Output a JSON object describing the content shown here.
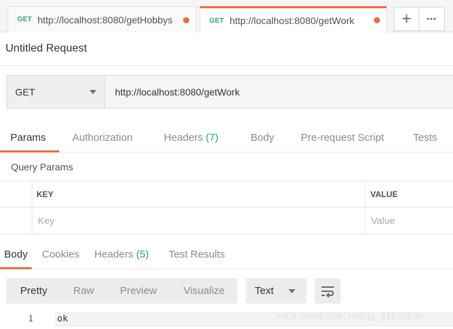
{
  "tabs": [
    {
      "method": "GET",
      "url": "http://localhost:8080/getHobbys",
      "unsaved": true,
      "active": false
    },
    {
      "method": "GET",
      "url": "http://localhost:8080/getWork",
      "unsaved": true,
      "active": true
    }
  ],
  "tab_actions": {
    "add_icon": "plus-icon",
    "more_icon": "more-icon",
    "add_glyph": "+",
    "more_glyph": "•••"
  },
  "request": {
    "title": "Untitled Request",
    "method": "GET",
    "url": "http://localhost:8080/getWork"
  },
  "request_tabs": {
    "params": "Params",
    "authorization": "Authorization",
    "headers": "Headers",
    "headers_count": "(7)",
    "body": "Body",
    "pre_request_script": "Pre-request Script",
    "tests": "Tests"
  },
  "query_params": {
    "label": "Query Params",
    "columns": {
      "key": "KEY",
      "value": "VALUE"
    },
    "placeholders": {
      "key": "Key",
      "value": "Value"
    }
  },
  "response_tabs": {
    "body": "Body",
    "cookies": "Cookies",
    "headers": "Headers",
    "headers_count": "(5)",
    "test_results": "Test Results"
  },
  "response_toolbar": {
    "views": [
      "Pretty",
      "Raw",
      "Preview",
      "Visualize"
    ],
    "active_view": "Pretty",
    "format": "Text",
    "wrap_icon": "wrap-lines-icon"
  },
  "response_body": {
    "line_number": "1",
    "content": "ok"
  },
  "watermark": "https://blog.csdn.net/qq_41520636",
  "colors": {
    "accent": "#f26b3a",
    "method_get": "#2aa767",
    "count": "#2aa767"
  }
}
